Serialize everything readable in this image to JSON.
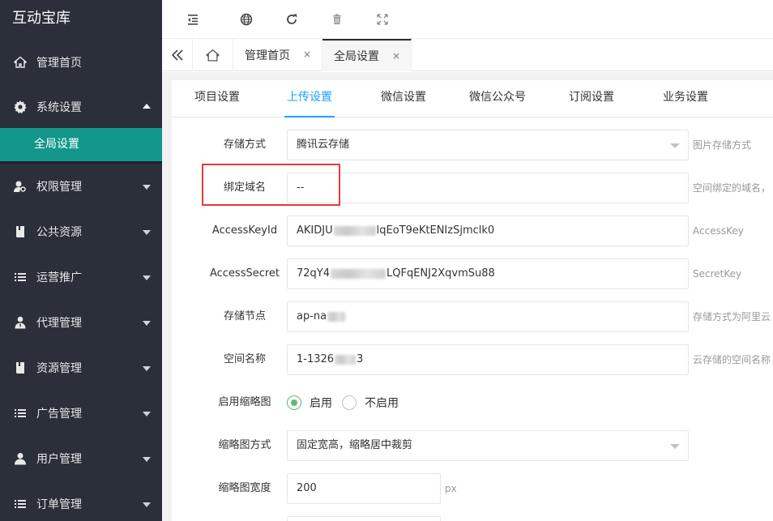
{
  "sidebar": {
    "brand": "互动宝库",
    "items": [
      {
        "label": "管理首页",
        "icon": "home-icon"
      },
      {
        "label": "系统设置",
        "icon": "gear-icon",
        "expanded": true,
        "children": [
          {
            "label": "全局设置"
          }
        ]
      },
      {
        "label": "权限管理",
        "icon": "user-key-icon"
      },
      {
        "label": "公共资源",
        "icon": "book-icon"
      },
      {
        "label": "运营推广",
        "icon": "list-icon"
      },
      {
        "label": "代理管理",
        "icon": "agent-icon"
      },
      {
        "label": "资源管理",
        "icon": "book-icon"
      },
      {
        "label": "广告管理",
        "icon": "list-icon"
      },
      {
        "label": "用户管理",
        "icon": "user-icon"
      },
      {
        "label": "订单管理",
        "icon": "list-icon"
      }
    ]
  },
  "tabstrip": {
    "tabs": [
      {
        "label": "管理首页",
        "close": "×"
      },
      {
        "label": "全局设置",
        "close": "×"
      }
    ]
  },
  "subtabs": [
    "项目设置",
    "上传设置",
    "微信设置",
    "微信公众号",
    "订阅设置",
    "业务设置"
  ],
  "form": {
    "storage": {
      "label": "存储方式",
      "value": "腾讯云存储",
      "hint": "图片存储方式"
    },
    "domain": {
      "label": "绑定域名",
      "value": "--",
      "hint": "空间绑定的域名，"
    },
    "access_key": {
      "label": "AccessKeyId",
      "value_start": "AKIDJU",
      "value_end": "lqEoT9eKtENIzSjmclk0",
      "hint": "AccessKey"
    },
    "access_secret": {
      "label": "AccessSecret",
      "value_start": "72qY4",
      "value_end": "LQFqENJ2XqvmSu88",
      "hint": "SecretKey"
    },
    "node": {
      "label": "存储节点",
      "value_start": "ap-na",
      "hint": "存储方式为阿里云"
    },
    "bucket": {
      "label": "空间名称",
      "value_start": "1-1326",
      "value_end": "3",
      "hint": "云存储的空间名称"
    },
    "thumb_enable": {
      "label": "启用缩略图",
      "options": [
        "启用",
        "不启用"
      ],
      "selected": "启用"
    },
    "thumb_mode": {
      "label": "缩略图方式",
      "value": "固定宽高，缩略居中裁剪"
    },
    "thumb_width": {
      "label": "缩略图宽度",
      "value": "200",
      "unit": "px"
    }
  },
  "colors": {
    "sidebar_bg": "#2a2f3a",
    "active_item": "#13978a",
    "tab_active": "#1e9fff",
    "radio_checked": "#5fb878",
    "highlight": "#e4393c"
  }
}
